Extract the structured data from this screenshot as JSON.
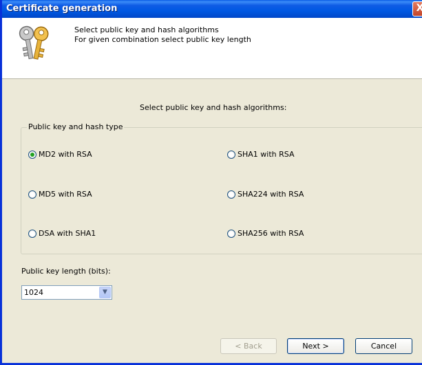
{
  "window": {
    "title": "Certificate generation",
    "close_glyph": "X"
  },
  "header": {
    "line1": "Select public key and hash algorithms",
    "line2": "For given combination select public key length",
    "icon": "keys-icon"
  },
  "main": {
    "heading": "Select public key and hash algorithms:",
    "group_label": "Public key and hash type",
    "options": [
      {
        "label": "MD2 with RSA",
        "checked": true
      },
      {
        "label": "SHA1 with RSA",
        "checked": false
      },
      {
        "label": "MD5 with RSA",
        "checked": false
      },
      {
        "label": "SHA224 with RSA",
        "checked": false
      },
      {
        "label": "DSA with SHA1",
        "checked": false
      },
      {
        "label": "SHA256 with RSA",
        "checked": false
      }
    ],
    "key_length_label": "Public key length (bits):",
    "key_length_value": "1024"
  },
  "buttons": {
    "back": "< Back",
    "next": "Next >",
    "cancel": "Cancel"
  },
  "colors": {
    "title_blue": "#0058E2",
    "close_red": "#C2452B",
    "radio_dot": "#21A121"
  }
}
